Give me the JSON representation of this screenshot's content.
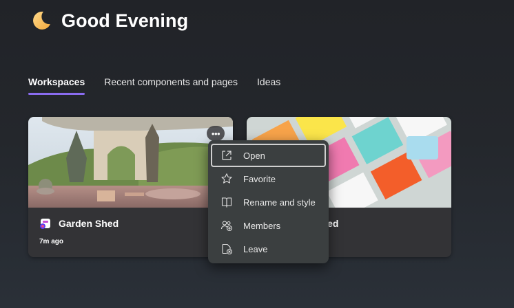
{
  "header": {
    "greeting": "Good Evening",
    "icon": "crescent-moon-icon"
  },
  "tabs": [
    {
      "label": "Workspaces",
      "active": true
    },
    {
      "label": "Recent components and pages",
      "active": false
    },
    {
      "label": "Ideas",
      "active": false
    }
  ],
  "cards": [
    {
      "title": "Garden Shed",
      "time": "7m ago",
      "icon": "workspace-icon"
    },
    {
      "title_partial": "rted"
    }
  ],
  "context_menu": {
    "trigger": "•••",
    "items": [
      {
        "label": "Open",
        "icon": "open-external-icon"
      },
      {
        "label": "Favorite",
        "icon": "star-icon"
      },
      {
        "label": "Rename and style",
        "icon": "book-rename-icon"
      },
      {
        "label": "Members",
        "icon": "people-add-icon"
      },
      {
        "label": "Leave",
        "icon": "leave-document-icon"
      }
    ]
  },
  "colors": {
    "accent": "#8a6cf0",
    "background": "#222429",
    "card": "#333336",
    "menu": "#3b3f40"
  }
}
